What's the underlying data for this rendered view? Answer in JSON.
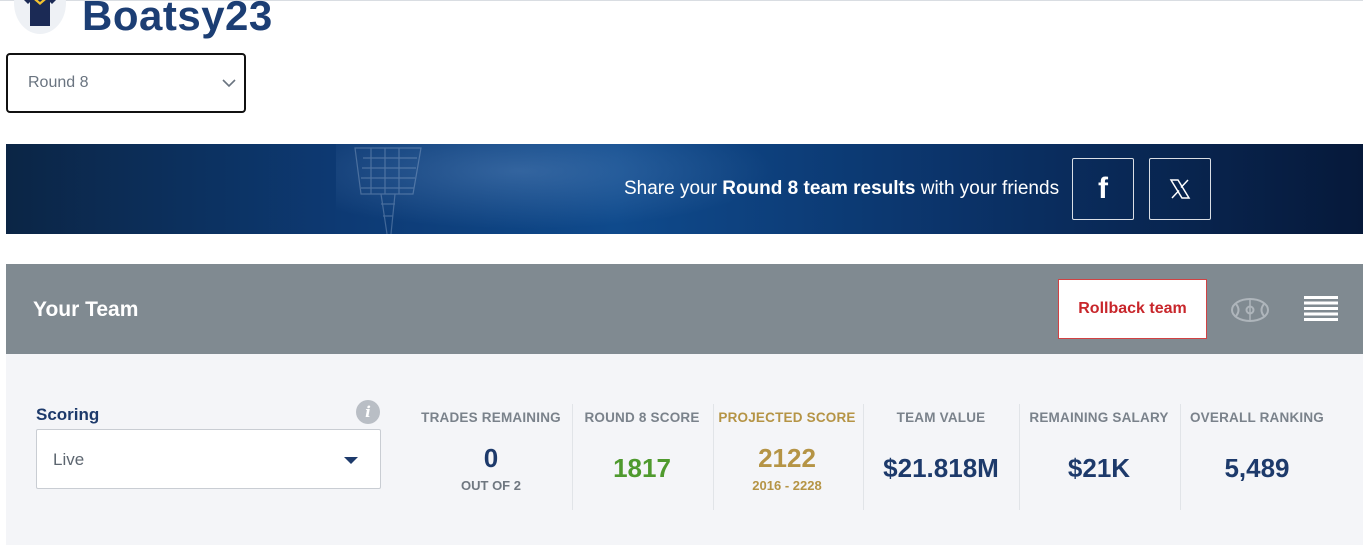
{
  "header": {
    "username": "Boatsy23",
    "round_select": {
      "value": "Round 8"
    }
  },
  "share_banner": {
    "text_prefix": "Share your ",
    "text_bold": "Round 8 team results",
    "text_suffix": " with your friends",
    "facebook_icon": "facebook-icon",
    "x_icon": "x-twitter-icon"
  },
  "team_bar": {
    "title": "Your Team",
    "rollback_label": "Rollback team",
    "field_view_icon": "football-field-icon",
    "list_view_icon": "list-view-icon"
  },
  "scoring": {
    "label": "Scoring",
    "value": "Live",
    "info_glyph": "i"
  },
  "stats": [
    {
      "label": "TRADES REMAINING",
      "value": "0",
      "sub": "OUT OF 2"
    },
    {
      "label": "ROUND 8 SCORE",
      "value": "1817",
      "sub": ""
    },
    {
      "label": "PROJECTED SCORE",
      "value": "2122",
      "sub": "2016 - 2228"
    },
    {
      "label": "TEAM VALUE",
      "value": "$21.818M",
      "sub": ""
    },
    {
      "label": "REMAINING SALARY",
      "value": "$21K",
      "sub": ""
    },
    {
      "label": "OVERALL RANKING",
      "value": "5,489",
      "sub": ""
    }
  ],
  "colors": {
    "navy": "#1c3e74",
    "score_green": "#4f9a2e",
    "projected_gold": "#b59445",
    "rollback_red": "#c8262b",
    "team_bar_grey": "#808a91",
    "panel_bg": "#f4f5f8"
  }
}
